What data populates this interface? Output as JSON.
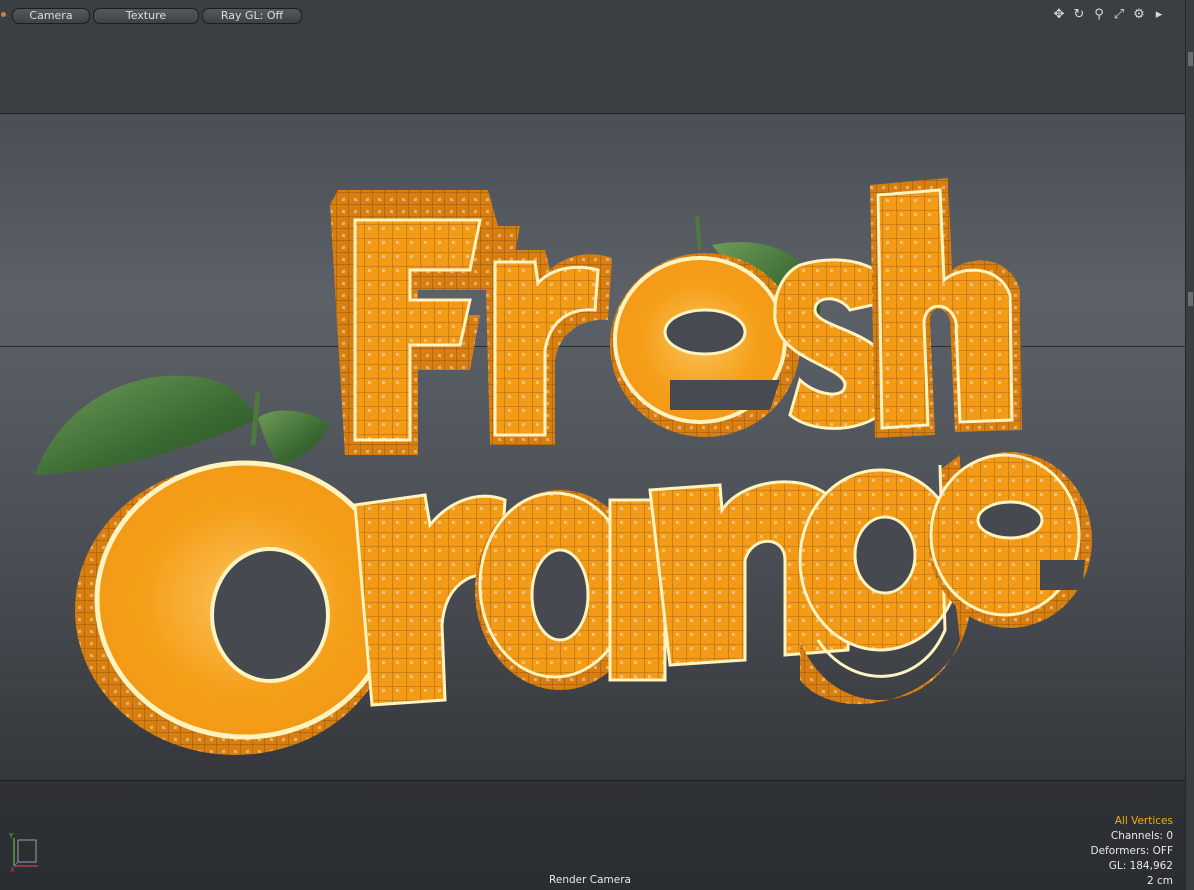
{
  "toolbar": {
    "camera_label": "Camera",
    "texture_label": "Texture",
    "raygl_label": "Ray GL: Off",
    "icons": [
      "move-icon",
      "rotate-icon",
      "zoom-icon",
      "fit-icon",
      "gear-icon",
      "arrow-right-icon"
    ]
  },
  "scene": {
    "word1": "Fresh",
    "word2": "Orange",
    "colors": {
      "orange": "#f39a17",
      "rim": "#fff3c0",
      "leaf": "#3f6b33",
      "wire": "#5b3a12"
    }
  },
  "info": {
    "selection_mode": "All Vertices",
    "channels": "Channels: 0",
    "deformers": "Deformers: OFF",
    "gl": "GL: 184,962",
    "grid": "2 cm"
  },
  "status": {
    "camera_name": "Render Camera"
  }
}
